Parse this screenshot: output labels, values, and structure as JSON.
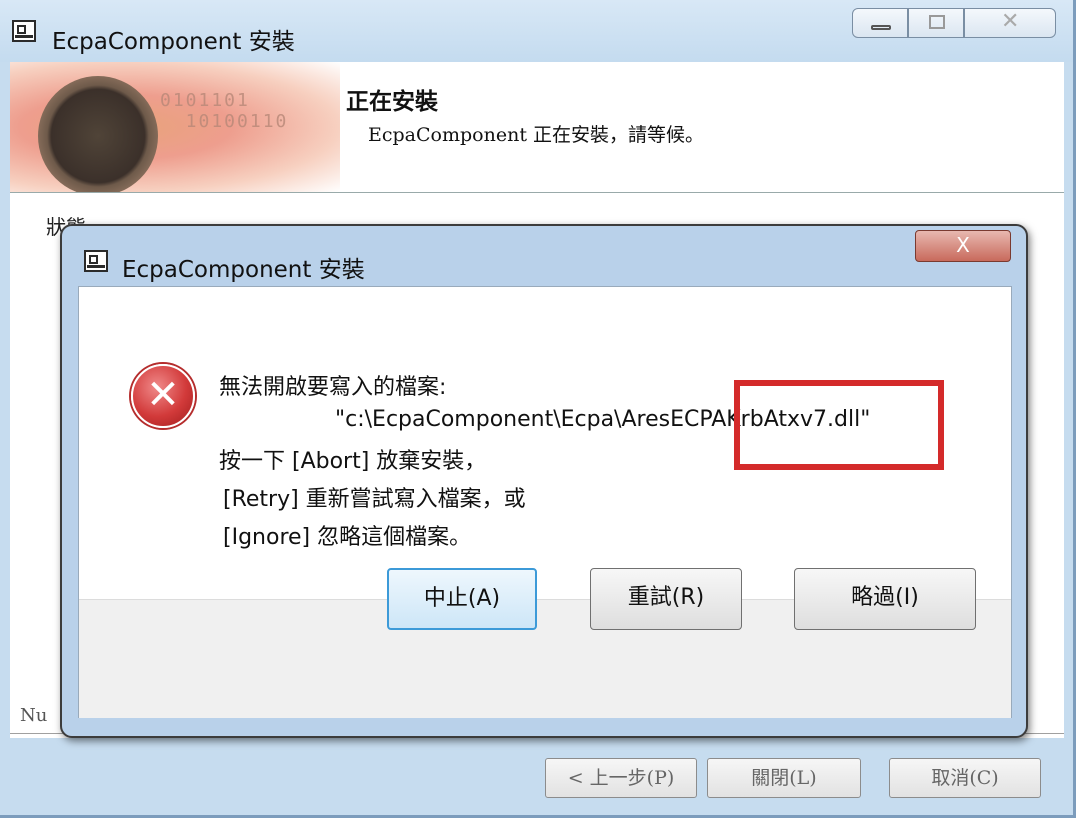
{
  "outer_window": {
    "title": "EcpaComponent 安裝",
    "banner": {
      "heading": "正在安裝",
      "subtitle": "EcpaComponent 正在安裝，請等候。"
    },
    "status_label": "狀態:",
    "null_text": "Nu",
    "buttons": {
      "back": "< 上一步(P)",
      "close": "關閉(L)",
      "cancel": "取消(C)"
    }
  },
  "dialog": {
    "title": "EcpaComponent 安裝",
    "close_glyph": "X",
    "message": {
      "line1": "無法開啟要寫入的檔案:",
      "line2": "\"c:\\EcpaComponent\\Ecpa\\AresECPAKrbAtxv7.dll\"",
      "line3": "按一下 [Abort] 放棄安裝，",
      "line4": "[Retry] 重新嘗試寫入檔案，或",
      "line5": "[Ignore] 忽略這個檔案。"
    },
    "buttons": {
      "abort": "中止(A)",
      "retry": "重試(R)",
      "ignore": "略過(I)"
    },
    "highlight_color": "#d42a2a"
  },
  "icons": {
    "app": "installer-app-icon",
    "error": "error-x-icon"
  }
}
